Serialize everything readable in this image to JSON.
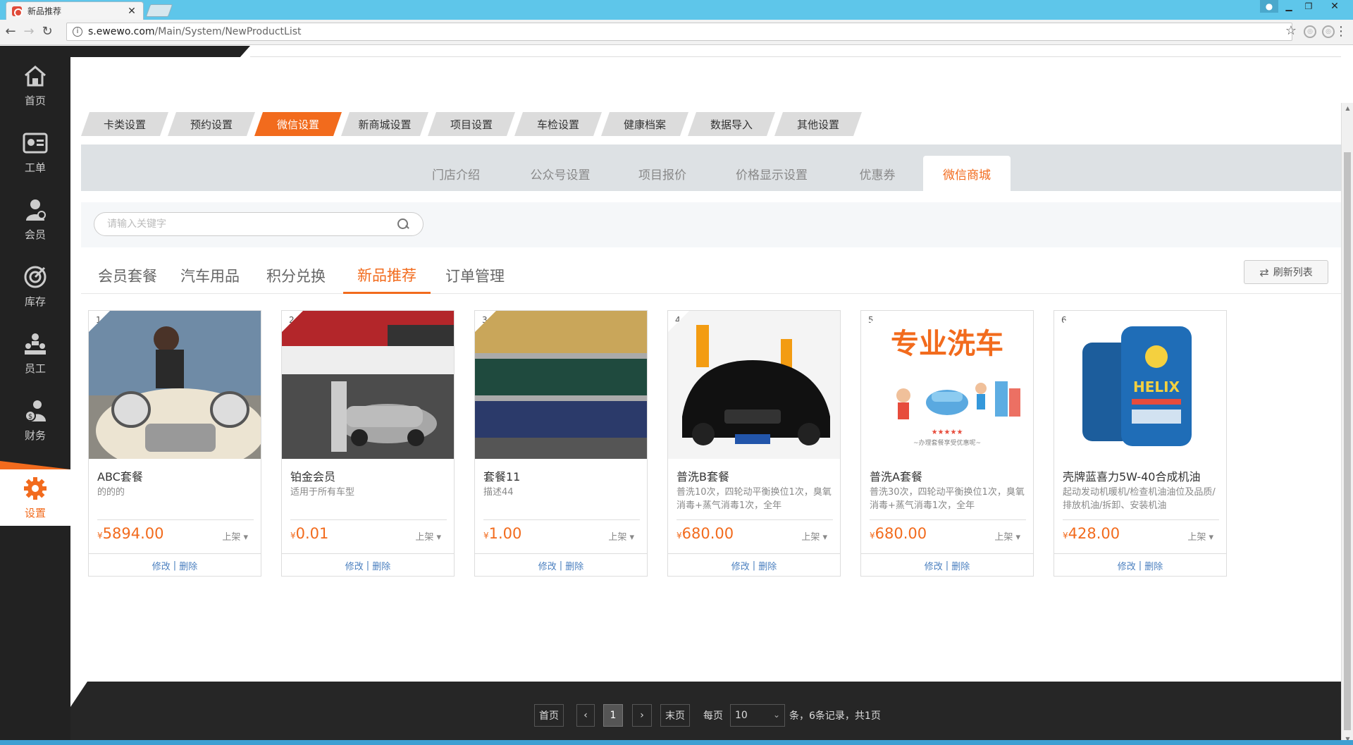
{
  "browser": {
    "tab_title": "新品推荐",
    "url_host": "s.ewewo.com",
    "url_path": "/Main/System/NewProductList"
  },
  "sidebar": {
    "items": [
      {
        "label": "首页",
        "icon": "home-icon"
      },
      {
        "label": "工单",
        "icon": "ticket-icon"
      },
      {
        "label": "会员",
        "icon": "member-icon"
      },
      {
        "label": "库存",
        "icon": "inventory-icon"
      },
      {
        "label": "员工",
        "icon": "staff-icon"
      },
      {
        "label": "财务",
        "icon": "finance-icon"
      },
      {
        "label": "设置",
        "icon": "gear-icon",
        "active": true
      }
    ]
  },
  "top_tabs": [
    "卡类设置",
    "预约设置",
    "微信设置",
    "新商城设置",
    "项目设置",
    "车检设置",
    "健康档案",
    "数据导入",
    "其他设置"
  ],
  "top_tabs_active": "微信设置",
  "sub_tabs": [
    "门店介绍",
    "公众号设置",
    "项目报价",
    "价格显示设置",
    "优惠券",
    "微信商城"
  ],
  "sub_tabs_active": "微信商城",
  "search": {
    "placeholder": "请输入关键字"
  },
  "category_tabs": [
    "会员套餐",
    "汽车用品",
    "积分兑换",
    "新品推荐",
    "订单管理"
  ],
  "category_tabs_active": "新品推荐",
  "refresh_label": "刷新列表",
  "products": [
    {
      "index": "1",
      "name": "ABC套餐",
      "desc": "的的的",
      "currency": "¥",
      "price": "5894.00",
      "status": "上架",
      "edit": "修改",
      "delete": "删除"
    },
    {
      "index": "2",
      "name": "铂金会员",
      "desc": "适用于所有车型",
      "currency": "¥",
      "price": "0.01",
      "status": "上架",
      "edit": "修改",
      "delete": "删除"
    },
    {
      "index": "3",
      "name": "套餐11",
      "desc": "描述44",
      "currency": "¥",
      "price": "1.00",
      "status": "上架",
      "edit": "修改",
      "delete": "删除"
    },
    {
      "index": "4",
      "name": "普洗B套餐",
      "desc": "普洗10次，四轮动平衡换位1次，臭氧消毒+蒸气消毒1次，全年",
      "currency": "¥",
      "price": "680.00",
      "status": "上架",
      "edit": "修改",
      "delete": "删除"
    },
    {
      "index": "5",
      "name": "普洗A套餐",
      "desc": "普洗30次，四轮动平衡换位1次，臭氧消毒+蒸气消毒1次，全年",
      "currency": "¥",
      "price": "680.00",
      "status": "上架",
      "edit": "修改",
      "delete": "删除",
      "img_text": "专业洗车",
      "img_sub": "~办理套餐享受优惠呢~"
    },
    {
      "index": "6",
      "name": "壳牌蓝喜力5W-40合成机油",
      "desc": "起动发动机暖机/检查机油油位及品质/排放机油/拆卸、安装机油",
      "currency": "¥",
      "price": "428.00",
      "status": "上架",
      "edit": "修改",
      "delete": "删除",
      "img_text": "HELIX"
    }
  ],
  "pagination": {
    "first": "首页",
    "prev": "‹",
    "current": "1",
    "next": "›",
    "last": "末页",
    "per_page_label": "每页",
    "per_page": "10",
    "summary": "条，6条记录，共1页"
  },
  "colors": {
    "accent": "#f26b1d",
    "sidebar": "#222222",
    "titlebar": "#5ec6ea"
  }
}
